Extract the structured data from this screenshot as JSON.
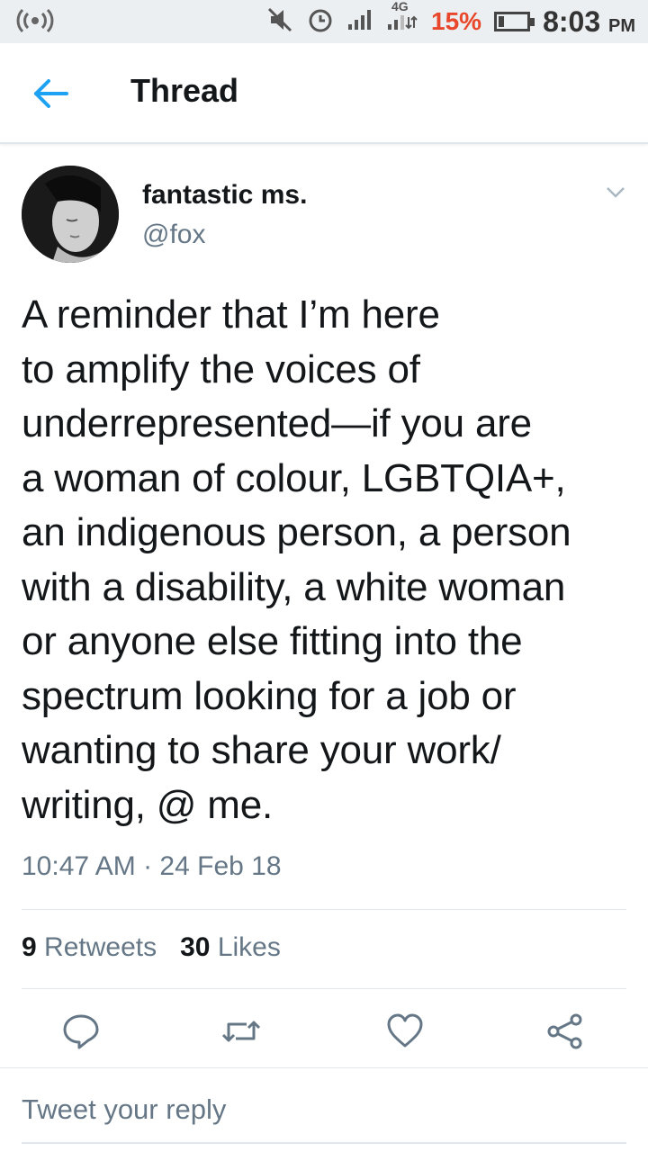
{
  "status_bar": {
    "network_label": "4G",
    "battery_percent": "15%",
    "time": "8:03",
    "time_suffix": "PM"
  },
  "header": {
    "title": "Thread"
  },
  "tweet": {
    "display_name": "fantastic ms.",
    "handle": "@fox",
    "text_lines": [
      "A reminder that I’m here",
      "to amplify the voices of",
      "underrepresented—if you are",
      "a woman of colour, LGBTQIA+,",
      "an indigenous person, a person",
      "with a disability, a white woman",
      "or anyone else fitting into the",
      "spectrum looking for a job or",
      "wanting to share your work/",
      "writing, @ me."
    ],
    "timestamp": "10:47 AM · 24 Feb 18",
    "retweets_count": "9",
    "retweets_label": "Retweets",
    "likes_count": "30",
    "likes_label": "Likes"
  },
  "reply": {
    "placeholder": "Tweet your reply"
  },
  "colors": {
    "accent": "#1da1f2",
    "text_primary": "#14171a",
    "text_secondary": "#657786",
    "divider": "#e1e8ed",
    "battery_low": "#e8472b"
  },
  "icons": {
    "back": "arrow-left-icon",
    "caret": "chevron-down-icon",
    "reply": "speech-bubble-icon",
    "retweet": "retweet-icon",
    "like": "heart-icon",
    "share": "share-icon"
  }
}
